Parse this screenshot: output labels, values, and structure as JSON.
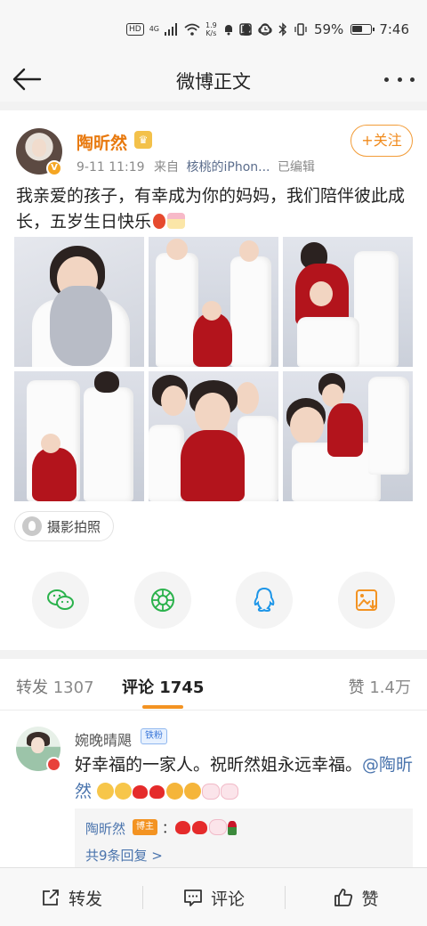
{
  "status_bar": {
    "hd": "HD",
    "network": "4G",
    "speed_value": "1.9",
    "speed_unit": "K/s",
    "battery_percent": "59%",
    "battery_level": 0.59,
    "time": "7:46"
  },
  "header": {
    "title": "微博正文"
  },
  "post": {
    "author": "陶昕然",
    "meta_time": "9-11 11:19",
    "meta_from": "来自",
    "meta_source": "核桃的iPhon...",
    "meta_edited": "已编辑",
    "follow_label": "+关注",
    "text": "我亲爱的孩子，有幸成为你的妈妈，我们陪伴彼此成长，五岁生日快乐",
    "tag": "摄影拍照"
  },
  "share_icons": [
    "wechat-icon",
    "moments-icon",
    "qq-icon",
    "save-image-icon"
  ],
  "tabs": [
    {
      "label": "转发",
      "count": "1307"
    },
    {
      "label": "评论",
      "count": "1745"
    },
    {
      "label": "赞",
      "count": "1.4万"
    }
  ],
  "comment": {
    "name": "婉晚晴飓",
    "badge": "铁粉",
    "text": "好幸福的一家人。祝昕然姐永远幸福。",
    "mention": "@陶昕然",
    "reply": {
      "name": "陶昕然",
      "badge": "博主",
      "prefix": "：",
      "more": "共9条回复 >"
    }
  },
  "bottom_bar": {
    "repost": "转发",
    "comment": "评论",
    "like": "赞"
  },
  "colors": {
    "accent": "#f39322",
    "author_orange": "#e8790e",
    "link_blue": "#4a74ad"
  }
}
